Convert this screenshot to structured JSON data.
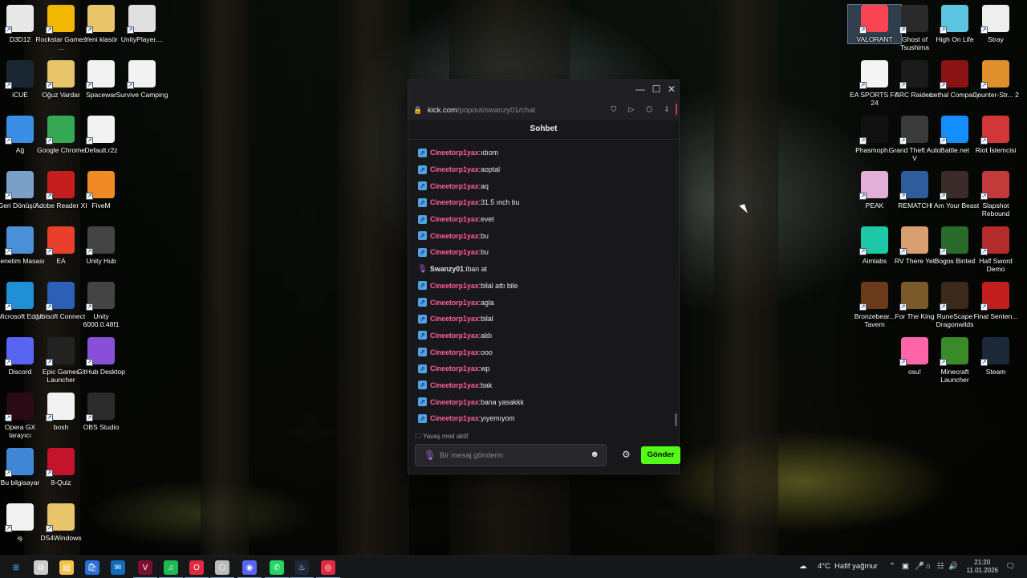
{
  "desktop": {
    "left_icons": [
      {
        "label": "D3D12",
        "icon": "folder-file-icon"
      },
      {
        "label": "Rockstar Games ...",
        "icon": "rockstar-icon"
      },
      {
        "label": "Yeni klasör",
        "icon": "folder-icon"
      },
      {
        "label": "UnityPlayer....",
        "icon": "settings-file-icon"
      },
      {
        "label": "iCUE",
        "icon": "icue-icon"
      },
      {
        "label": "Oğuz Vardar",
        "icon": "folder-icon"
      },
      {
        "label": "Spacewar",
        "icon": "file-icon"
      },
      {
        "label": "Survive Camping",
        "icon": "file-icon"
      },
      {
        "label": "Ağ",
        "icon": "network-icon"
      },
      {
        "label": "Google Chrome",
        "icon": "chrome-icon"
      },
      {
        "label": "Default.r2z",
        "icon": "file-icon"
      },
      {
        "label": "Geri Dönüşü...",
        "icon": "recycle-bin-icon"
      },
      {
        "label": "Adobe Reader XI",
        "icon": "adobe-icon"
      },
      {
        "label": "FiveM",
        "icon": "fivem-icon"
      },
      {
        "label": "Denetim Masası",
        "icon": "control-panel-icon"
      },
      {
        "label": "EA",
        "icon": "ea-icon"
      },
      {
        "label": "Unity Hub",
        "icon": "unity-icon"
      },
      {
        "label": "Microsoft Edge",
        "icon": "edge-icon"
      },
      {
        "label": "Ubisoft Connect",
        "icon": "ubisoft-icon"
      },
      {
        "label": "Unity 6000.0.48f1",
        "icon": "unity-icon"
      },
      {
        "label": "Discord",
        "icon": "discord-icon"
      },
      {
        "label": "Epic Games Launcher",
        "icon": "epic-icon"
      },
      {
        "label": "GitHub Desktop",
        "icon": "github-icon"
      },
      {
        "label": "Opera GX tarayıcı",
        "icon": "opera-gx-icon"
      },
      {
        "label": "bosh",
        "icon": "file-icon"
      },
      {
        "label": "OBS Studio",
        "icon": "obs-icon"
      },
      {
        "label": "Bu bilgisayar",
        "icon": "computer-icon"
      },
      {
        "label": "8-Quiz",
        "icon": "opera-icon"
      },
      {
        "label": "iş",
        "icon": "file-icon"
      },
      {
        "label": "DS4Windows",
        "icon": "folder-icon"
      }
    ],
    "right_icons": [
      {
        "label": "VALORANT",
        "icon": "valorant-icon"
      },
      {
        "label": "Ghost of Tsushima",
        "icon": "ghost-icon"
      },
      {
        "label": "High On Life",
        "icon": "highonlife-icon"
      },
      {
        "label": "Stray",
        "icon": "stray-icon"
      },
      {
        "label": "EA SPORTS FC 24",
        "icon": "fc24-icon"
      },
      {
        "label": "ARC Raiders",
        "icon": "arc-icon"
      },
      {
        "label": "Lethal Company",
        "icon": "lethal-icon"
      },
      {
        "label": "Counter-Str... 2",
        "icon": "cs2-icon"
      },
      {
        "label": "Phasmoph...",
        "icon": "phasmo-icon"
      },
      {
        "label": "Grand Theft Auto V",
        "icon": "gta-icon"
      },
      {
        "label": "Battle.net",
        "icon": "battlenet-icon"
      },
      {
        "label": "Riot İstemcisi",
        "icon": "riot-icon"
      },
      {
        "label": "PEAK",
        "icon": "peak-icon"
      },
      {
        "label": "REMATCH",
        "icon": "rematch-icon"
      },
      {
        "label": "I Am Your Beast",
        "icon": "beast-icon"
      },
      {
        "label": "Slapshot Rebound",
        "icon": "slapshot-icon"
      },
      {
        "label": "Aimlabs",
        "icon": "aimlabs-icon"
      },
      {
        "label": "RV There Yet",
        "icon": "rv-icon"
      },
      {
        "label": "Bogos Binted",
        "icon": "bogos-icon"
      },
      {
        "label": "Half Sword Demo",
        "icon": "halfsword-icon"
      },
      {
        "label": "Bronzebear... Tavern",
        "icon": "tavern-icon"
      },
      {
        "label": "For The King",
        "icon": "forking-icon"
      },
      {
        "label": "RuneScape Dragonwilds",
        "icon": "runescape-icon"
      },
      {
        "label": "Final Senten...",
        "icon": "finalsentence-icon"
      },
      {
        "label": "osu!",
        "icon": "osu-icon"
      },
      {
        "label": "Minecraft Launcher",
        "icon": "minecraft-icon"
      },
      {
        "label": "Steam",
        "icon": "steam-icon"
      }
    ]
  },
  "browser": {
    "url_domain": "kick.com",
    "url_path": "/popout/swanzy01/chat",
    "chat_title": "Sohbet",
    "messages": [
      {
        "user": "Cineetorp1yax",
        "text": "ıdıom",
        "badge": "blue",
        "color": "#ff5ea0"
      },
      {
        "user": "Cineetorp1yax",
        "text": "aoptal",
        "badge": "blue",
        "color": "#ff5ea0"
      },
      {
        "user": "Cineetorp1yax",
        "text": "aq",
        "badge": "blue",
        "color": "#ff5ea0"
      },
      {
        "user": "Cineetorp1yax",
        "text": "31.5 ınch bu",
        "badge": "blue",
        "color": "#ff5ea0"
      },
      {
        "user": "Cineetorp1yax",
        "text": "evet",
        "badge": "blue",
        "color": "#ff5ea0"
      },
      {
        "user": "Cineetorp1yax",
        "text": "bu",
        "badge": "blue",
        "color": "#ff5ea0"
      },
      {
        "user": "Cineetorp1yax",
        "text": "bu",
        "badge": "blue",
        "color": "#ff5ea0"
      },
      {
        "user": "Swanzy01",
        "text": "iban at",
        "badge": "mic",
        "color": "#e6e6e6"
      },
      {
        "user": "Cineetorp1yax",
        "text": "bilal attı bile",
        "badge": "blue",
        "color": "#ff5ea0"
      },
      {
        "user": "Cineetorp1yax",
        "text": "agla",
        "badge": "blue",
        "color": "#ff5ea0"
      },
      {
        "user": "Cineetorp1yax",
        "text": "bilal",
        "badge": "blue",
        "color": "#ff5ea0"
      },
      {
        "user": "Cineetorp1yax",
        "text": "aldı",
        "badge": "blue",
        "color": "#ff5ea0"
      },
      {
        "user": "Cineetorp1yax",
        "text": "ooo",
        "badge": "blue",
        "color": "#ff5ea0"
      },
      {
        "user": "Cineetorp1yax",
        "text": "wp",
        "badge": "blue",
        "color": "#ff5ea0"
      },
      {
        "user": "Cineetorp1yax",
        "text": "bak",
        "badge": "blue",
        "color": "#ff5ea0"
      },
      {
        "user": "Cineetorp1yax",
        "text": "bana yasakkk",
        "badge": "blue",
        "color": "#ff5ea0"
      },
      {
        "user": "Cineetorp1yax",
        "text": "yıyemıyom",
        "badge": "blue",
        "color": "#ff5ea0"
      }
    ],
    "slow_mode": "Yavaş mod aktif",
    "input_placeholder": "Bir mesaj gönderin",
    "send_label": "Gönder",
    "accent": "#53fc18"
  },
  "taskbar": {
    "weather_temp": "4°C",
    "weather_text": "Hafif yağmur",
    "time": "21:20",
    "date": "11.01.2026",
    "apps": [
      "start-icon",
      "task-view-icon",
      "file-explorer-icon",
      "microsoft-store-icon",
      "outlook-icon",
      "valorant-icon",
      "spotify-icon",
      "opera-gx-icon",
      "unity-icon",
      "discord-chrome-icon",
      "whatsapp-icon",
      "steam-icon",
      "obs-icon"
    ]
  }
}
